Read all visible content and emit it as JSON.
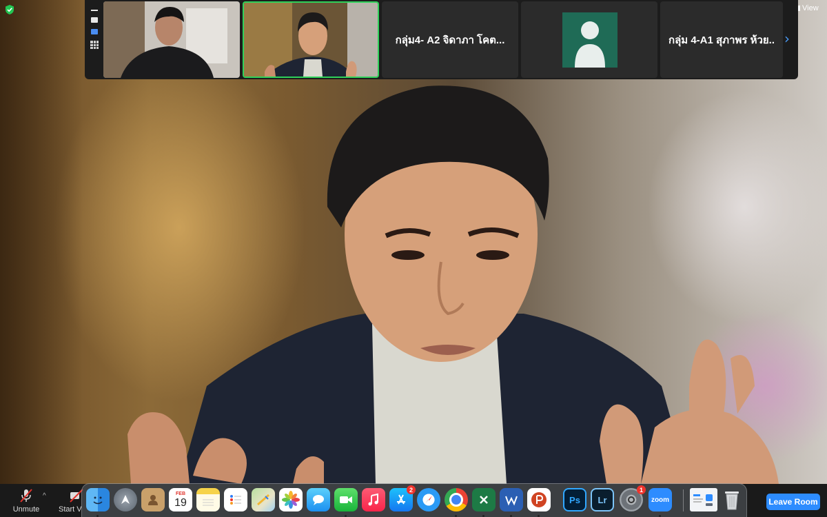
{
  "app": {
    "view_label": "View",
    "leave_label": "Leave Room"
  },
  "filmstrip": {
    "tiles": [
      {
        "name": "",
        "kind": "video-remote"
      },
      {
        "name": "",
        "kind": "video-active-speaker"
      },
      {
        "name": "กลุ่ม4- A2 จิดาภา โคต...",
        "kind": "name-only"
      },
      {
        "name": "",
        "kind": "avatar"
      },
      {
        "name": "กลุ่ม 4-A1 สุภาพร ห้วย..",
        "kind": "name-only"
      }
    ],
    "next_icon": "chevron-right-icon",
    "active_border_color": "#2fd25a"
  },
  "controls": {
    "unmute_label": "Unmute",
    "start_video_label": "Start V"
  },
  "dock": {
    "calendar_month": "FEB",
    "calendar_day": "19",
    "app_store_badge": "2",
    "settings_badge": "1",
    "ps_label": "Ps",
    "lr_label": "Lr",
    "zoom_label": "zoom",
    "apps": [
      "finder",
      "launchpad",
      "contacts",
      "calendar",
      "notes",
      "reminders",
      "maps",
      "photos",
      "messages",
      "facetime",
      "music",
      "app-store",
      "safari",
      "chrome",
      "excel",
      "word",
      "powerpoint",
      "photoshop",
      "lightroom",
      "system-preferences",
      "zoom",
      "preview",
      "trash"
    ]
  },
  "colors": {
    "accent_blue": "#2d8cff",
    "security_green": "#23c552",
    "badge_red": "#f0332b"
  }
}
